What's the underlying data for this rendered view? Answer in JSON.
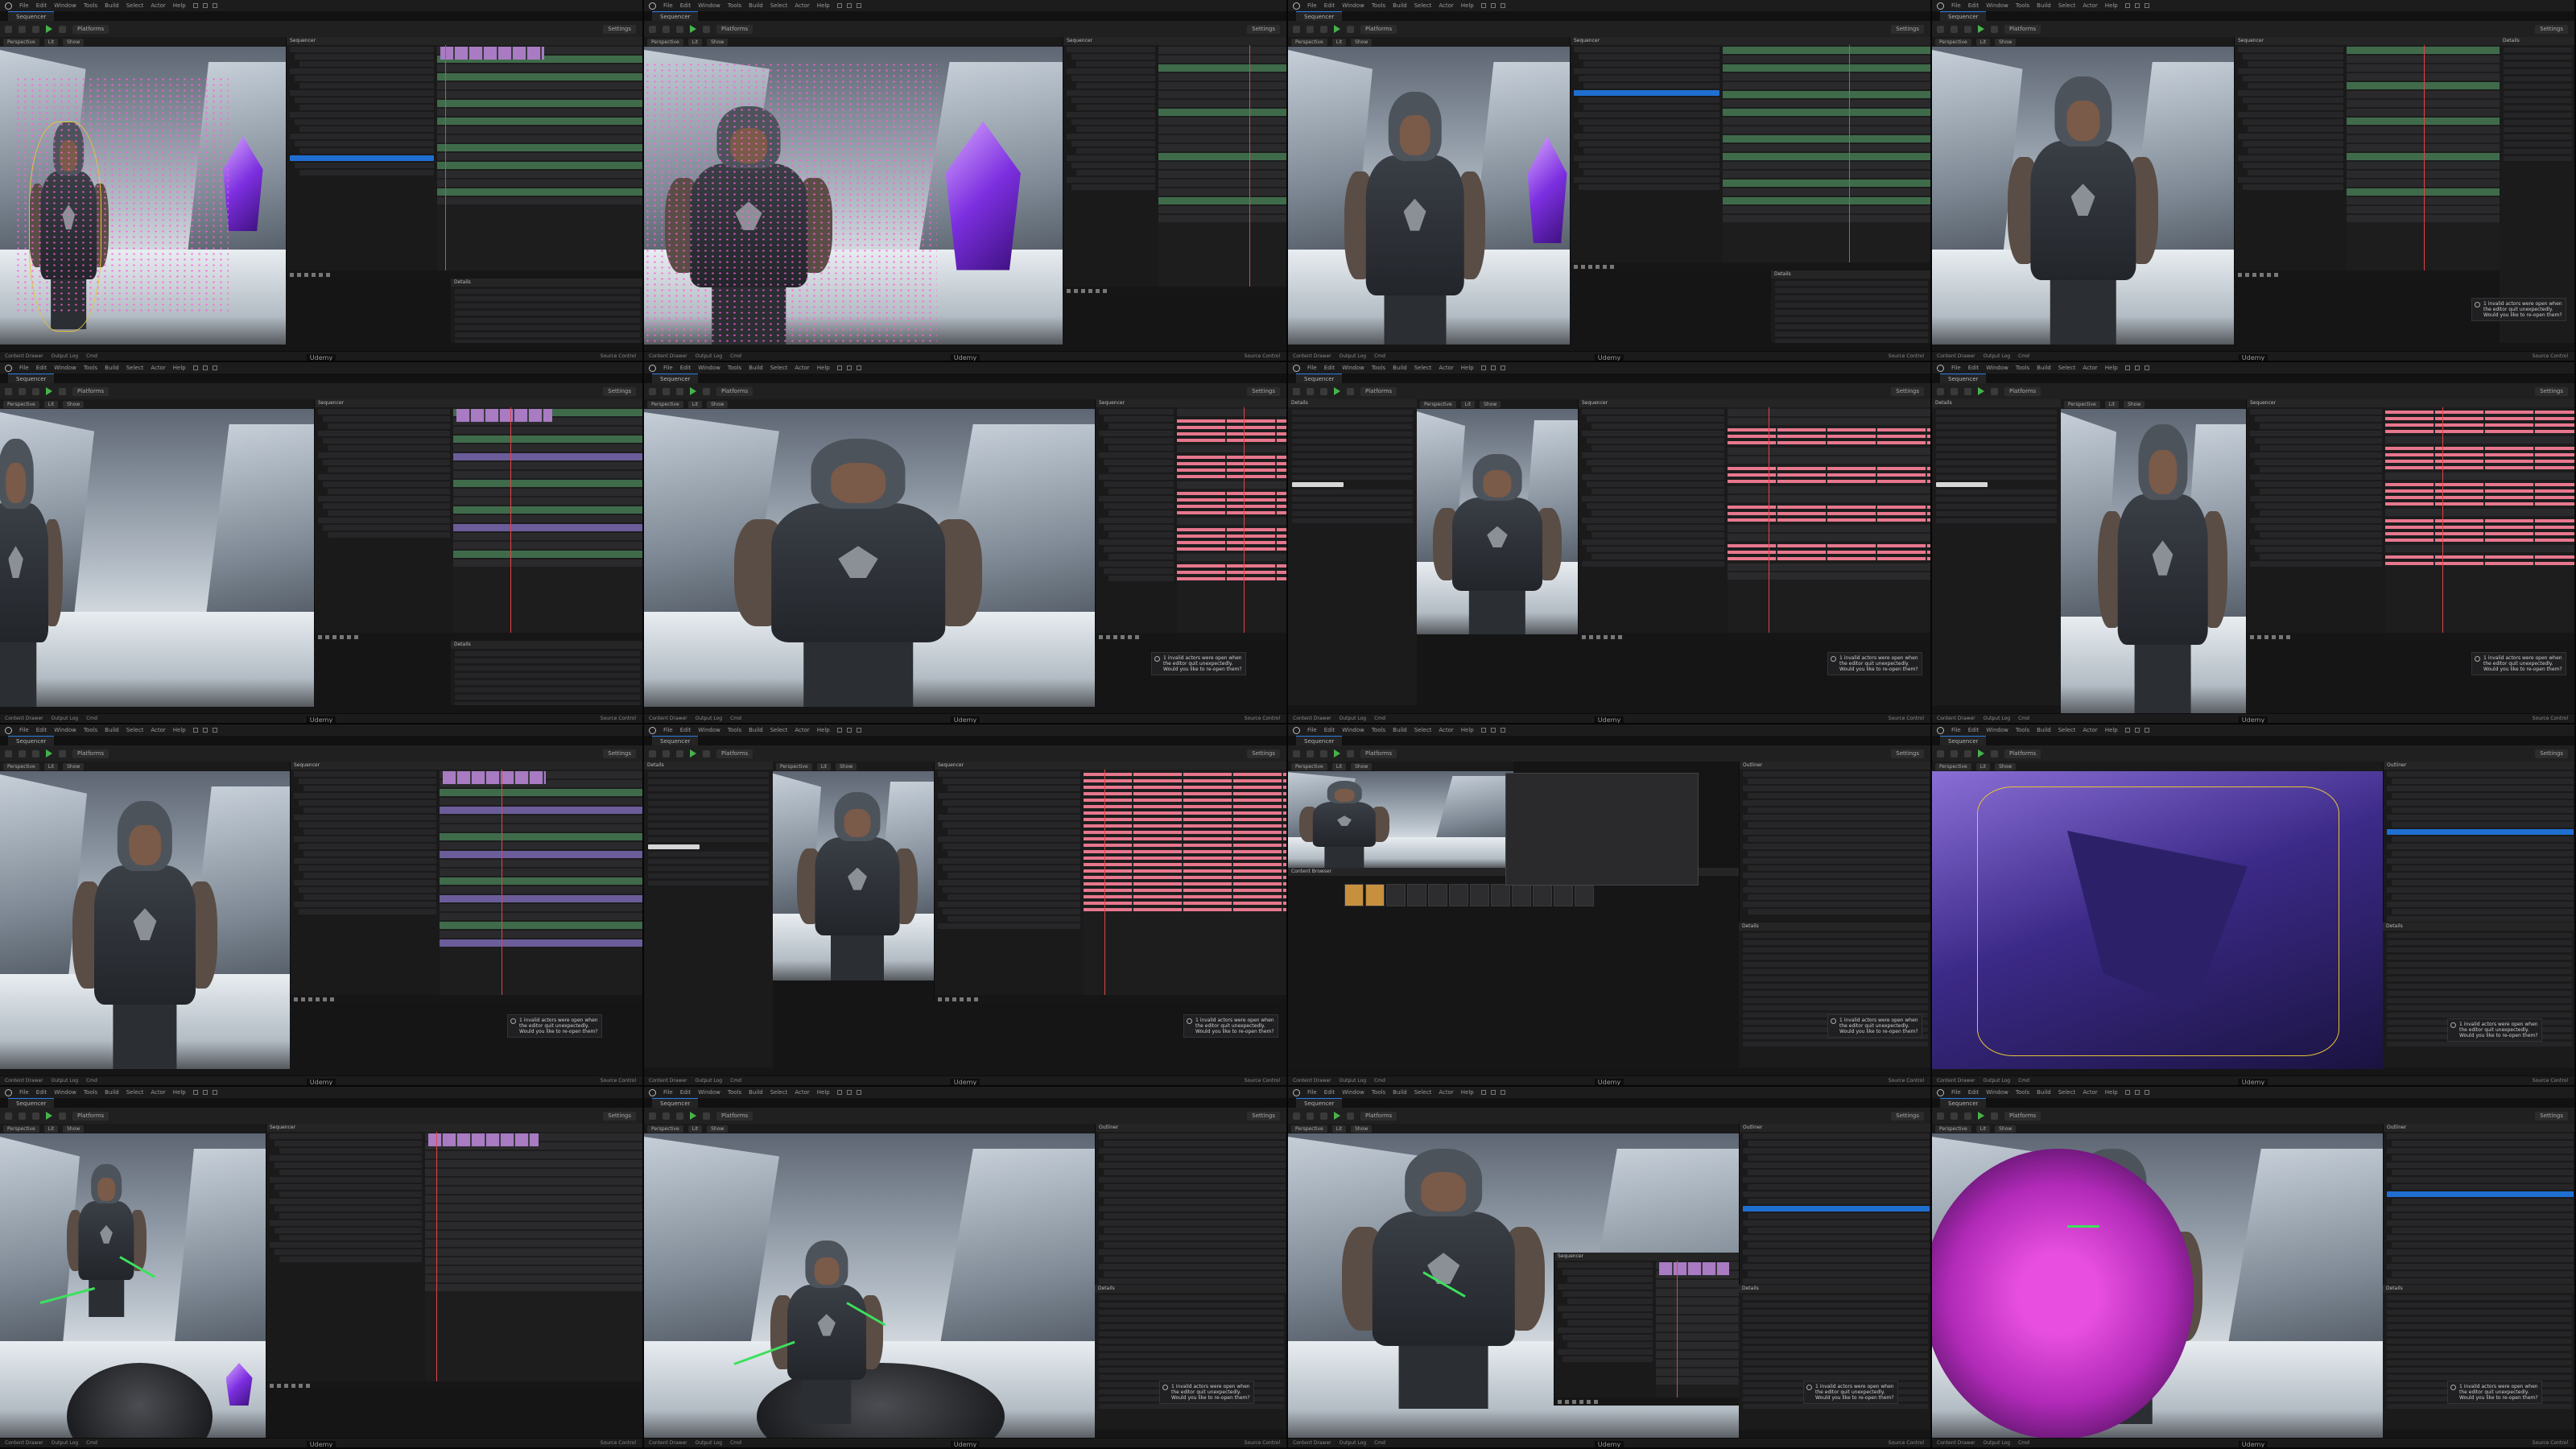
{
  "app": {
    "menu": [
      "File",
      "Edit",
      "Window",
      "Tools",
      "Build",
      "Select",
      "Actor",
      "Help"
    ],
    "project_tab": "Sequencer",
    "toolbar": {
      "platforms": "Platforms",
      "settings": "Settings"
    },
    "viewport_tabs": [
      "Perspective",
      "Lit",
      "Show"
    ],
    "panels": {
      "sequencer": "Sequencer",
      "outliner": "Outliner",
      "details": "Details",
      "content_browser": "Content Browser"
    },
    "status": {
      "content_drawer": "Content Drawer",
      "output_log": "Output Log",
      "cmd": "Cmd",
      "source_control": "Source Control"
    },
    "notification": "1 invalid actors were open when the editor quit unexpectedly. Would you like to re-open them?",
    "watermark": "Udemy"
  },
  "tiles": [
    {
      "id": 1,
      "scene": "sparkles"
    },
    {
      "id": 2,
      "scene": "sparkles-close"
    },
    {
      "id": 3,
      "scene": "hero-crystal"
    },
    {
      "id": 4,
      "scene": "hero-front"
    },
    {
      "id": 5,
      "scene": "hero-wide"
    },
    {
      "id": 6,
      "scene": "hero-pose"
    },
    {
      "id": 7,
      "scene": "hero-details"
    },
    {
      "id": 8,
      "scene": "hero-closeup"
    },
    {
      "id": 9,
      "scene": "hero-sequencer"
    },
    {
      "id": 10,
      "scene": "hero-keys"
    },
    {
      "id": 11,
      "scene": "content-browser"
    },
    {
      "id": 12,
      "scene": "purple-surface"
    },
    {
      "id": 13,
      "scene": "platform-gizmo"
    },
    {
      "id": 14,
      "scene": "outliner-gizmo"
    },
    {
      "id": 15,
      "scene": "sequencer-overlay"
    },
    {
      "id": 16,
      "scene": "magenta-shield"
    }
  ],
  "colors": {
    "accent": "#1f6fd1",
    "playhead": "#e04545",
    "keyframe": "#e7778d",
    "gizmo": "#3de05c",
    "particles": "#ff5ed8",
    "crystal": "#7c2fe0"
  }
}
